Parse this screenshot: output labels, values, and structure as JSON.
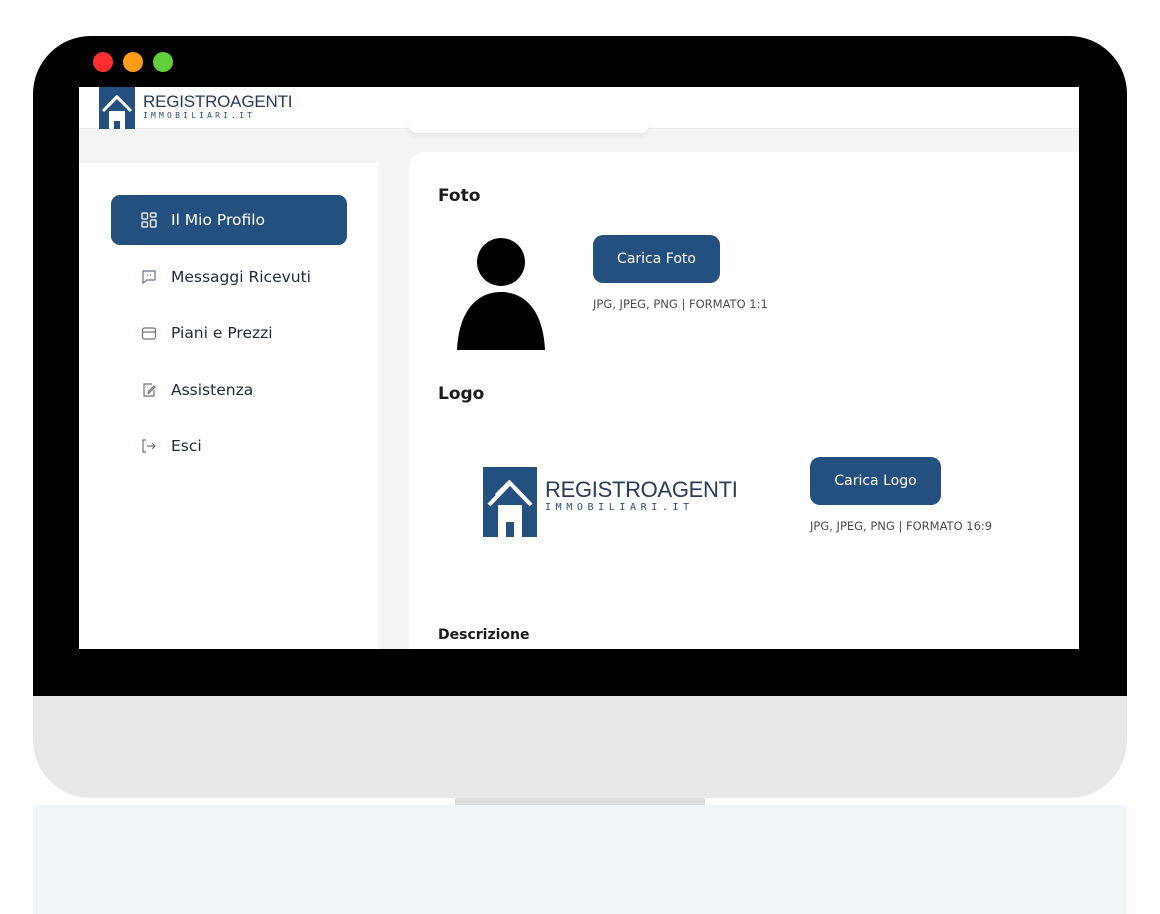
{
  "brand": {
    "title": "REGISTROAGENTI",
    "subtitle": "IMMOBILIARI.IT"
  },
  "sidebar": {
    "items": [
      {
        "label": "Il Mio Profilo",
        "icon": "grid-icon",
        "active": true
      },
      {
        "label": "Messaggi Ricevuti",
        "icon": "chat-icon",
        "active": false
      },
      {
        "label": "Piani e Prezzi",
        "icon": "box-icon",
        "active": false
      },
      {
        "label": "Assistenza",
        "icon": "edit-icon",
        "active": false
      },
      {
        "label": "Esci",
        "icon": "logout-icon",
        "active": false
      }
    ]
  },
  "main": {
    "foto": {
      "title": "Foto",
      "button": "Carica Foto",
      "hint": "JPG, JPEG, PNG | FORMATO 1:1"
    },
    "logo": {
      "title": "Logo",
      "button": "Carica Logo",
      "hint": "JPG, JPEG, PNG | FORMATO 16:9"
    },
    "descrizione": {
      "label": "Descrizione"
    }
  },
  "colors": {
    "accent": "#24507f",
    "brand_text": "#2a3b57"
  }
}
